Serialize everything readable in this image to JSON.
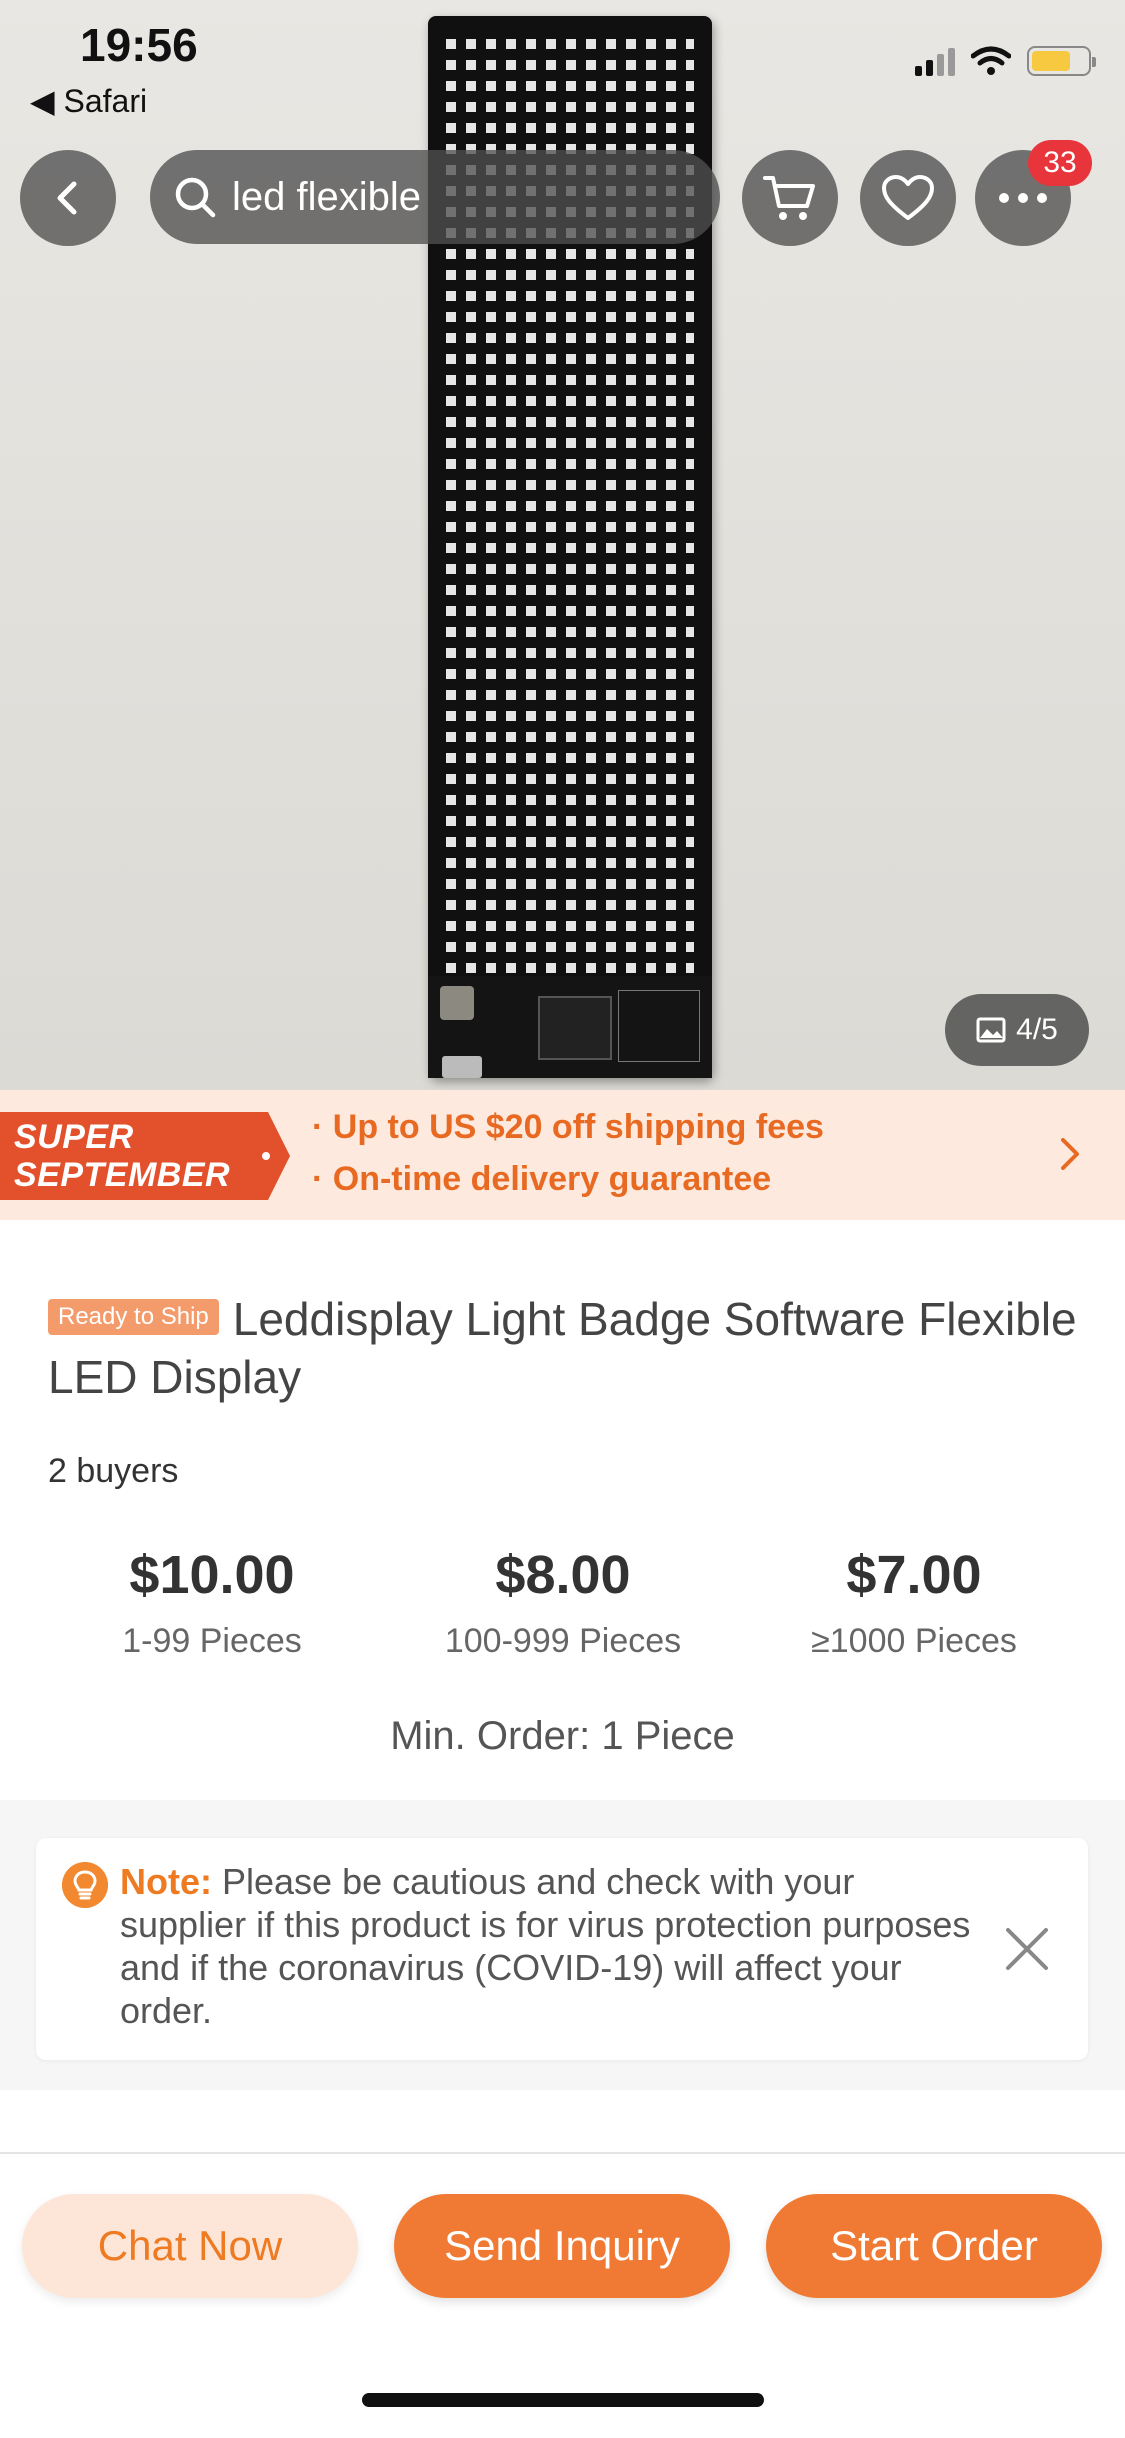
{
  "status_bar": {
    "time": "19:56",
    "back_app": "Safari"
  },
  "top_nav": {
    "search_query": "led flexible",
    "notification_count": "33",
    "icons": [
      "back-arrow-icon",
      "search-icon",
      "cart-icon",
      "heart-icon",
      "more-icon"
    ]
  },
  "gallery": {
    "counter": "4/5"
  },
  "promo": {
    "logo_line1": "SUPER",
    "logo_line2": "SEPTEMBER",
    "line1": "· Up to US $20 off shipping fees",
    "line2": "· On-time delivery guarantee"
  },
  "product": {
    "badge": "Ready to Ship",
    "title": "Leddisplay Light Badge Software Flexible LED Display",
    "buyers": "2 buyers",
    "tiers": [
      {
        "price": "$10.00",
        "qty": "1-99 Pieces"
      },
      {
        "price": "$8.00",
        "qty": "100-999 Pieces"
      },
      {
        "price": "$7.00",
        "qty": "≥1000 Pieces"
      }
    ],
    "min_order": "Min. Order: 1 Piece"
  },
  "note": {
    "label": "Note:",
    "text": " Please be cautious and check with your supplier if this product is for virus protection purposes and if the coronavirus (COVID-19) will affect your order."
  },
  "actions": {
    "chat": "Chat Now",
    "inquiry": "Send Inquiry",
    "order": "Start Order"
  },
  "colors": {
    "accent": "#f07a34",
    "promo_bg": "#fde9dd",
    "badge_red": "#e8343b"
  }
}
